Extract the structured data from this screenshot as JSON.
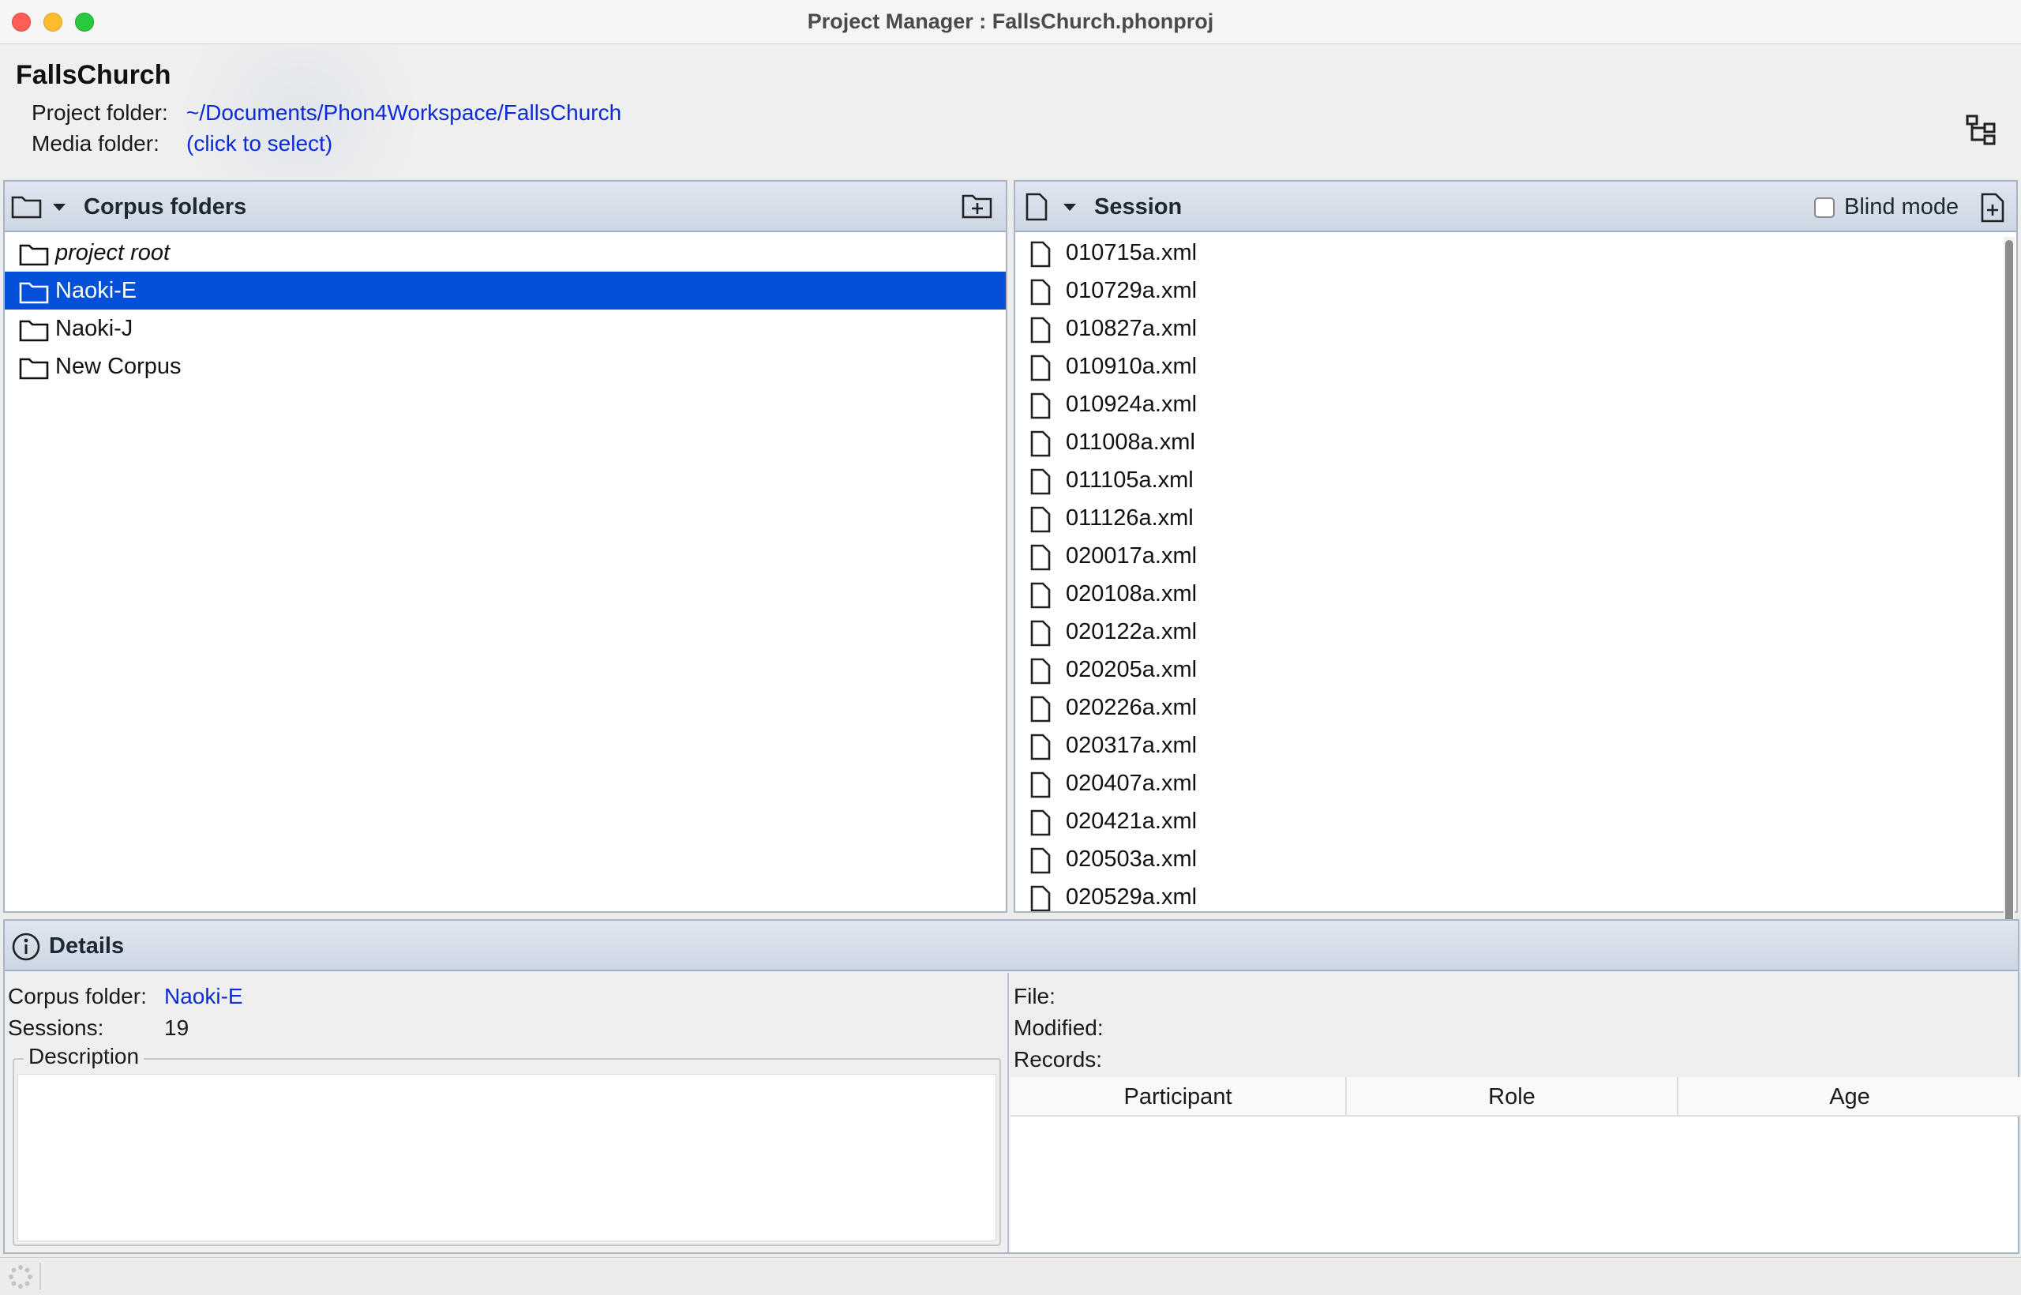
{
  "window": {
    "title": "Project Manager : FallsChurch.phonproj"
  },
  "header": {
    "project_name": "FallsChurch",
    "project_folder_label": "Project folder:",
    "project_folder_value": "~/Documents/Phon4Workspace/FallsChurch",
    "media_folder_label": "Media folder:",
    "media_folder_value": "(click to select)"
  },
  "corpus_panel": {
    "title": "Corpus folders",
    "items": [
      {
        "label": "project root",
        "italic": true,
        "selected": false
      },
      {
        "label": "Naoki-E",
        "italic": false,
        "selected": true
      },
      {
        "label": "Naoki-J",
        "italic": false,
        "selected": false
      },
      {
        "label": "New Corpus",
        "italic": false,
        "selected": false
      }
    ]
  },
  "session_panel": {
    "title": "Session",
    "blind_mode_label": "Blind mode",
    "blind_mode_checked": false,
    "items": [
      "010715a.xml",
      "010729a.xml",
      "010827a.xml",
      "010910a.xml",
      "010924a.xml",
      "011008a.xml",
      "011105a.xml",
      "011126a.xml",
      "020017a.xml",
      "020108a.xml",
      "020122a.xml",
      "020205a.xml",
      "020226a.xml",
      "020317a.xml",
      "020407a.xml",
      "020421a.xml",
      "020503a.xml",
      "020529a.xml"
    ]
  },
  "details": {
    "title": "Details",
    "corpus_folder_label": "Corpus folder:",
    "corpus_folder_value": "Naoki-E",
    "sessions_label": "Sessions:",
    "sessions_value": "19",
    "description_legend": "Description",
    "file_label": "File:",
    "modified_label": "Modified:",
    "records_label": "Records:",
    "table_columns": [
      "Participant",
      "Role",
      "Age"
    ]
  },
  "colors": {
    "selection": "#0550d9",
    "link": "#0b2bd6",
    "panel_header": "#d6dee9"
  }
}
